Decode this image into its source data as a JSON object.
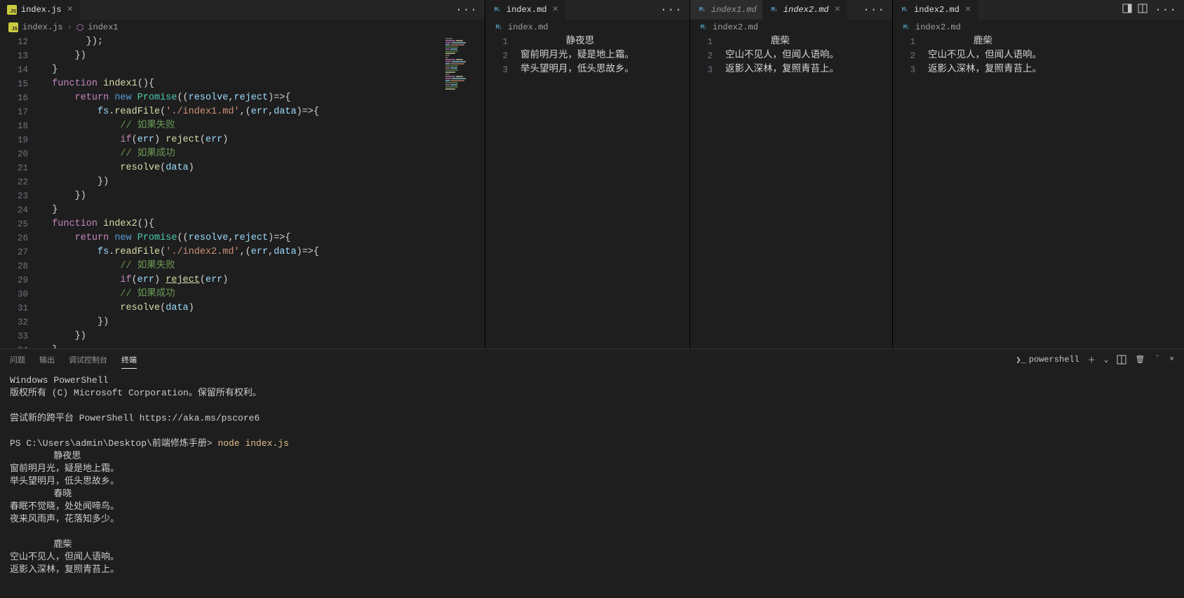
{
  "panes": [
    {
      "tabs": [
        {
          "label": "index.js",
          "icon": "js",
          "active": true,
          "italic": false,
          "closeable": true
        }
      ],
      "actions_dots": "···",
      "breadcrumb": [
        {
          "icon": "js",
          "label": "index.js"
        },
        {
          "icon": "sym",
          "label": "index1"
        }
      ],
      "line_start": 12,
      "code": [
        [
          [
            "punc",
            "        });"
          ]
        ],
        [
          [
            "punc",
            "      })"
          ]
        ],
        [
          [
            "punc",
            "  }"
          ]
        ],
        [
          [
            "kw",
            "  function "
          ],
          [
            "fn",
            "index1"
          ],
          [
            "punc",
            "(){"
          ]
        ],
        [
          [
            "kw",
            "      return "
          ],
          [
            "op",
            "new "
          ],
          [
            "cls",
            "Promise"
          ],
          [
            "punc",
            "(("
          ],
          [
            "var",
            "resolve"
          ],
          [
            "punc",
            ","
          ],
          [
            "var",
            "reject"
          ],
          [
            "punc",
            ")=>{"
          ]
        ],
        [
          [
            "var",
            "          fs"
          ],
          [
            "punc",
            "."
          ],
          [
            "fn",
            "readFile"
          ],
          [
            "punc",
            "("
          ],
          [
            "str",
            "'./index1.md'"
          ],
          [
            "punc",
            ",("
          ],
          [
            "var",
            "err"
          ],
          [
            "punc",
            ","
          ],
          [
            "var",
            "data"
          ],
          [
            "punc",
            ")=>{"
          ]
        ],
        [
          [
            "com",
            "              // 如果失败"
          ]
        ],
        [
          [
            "kw",
            "              if"
          ],
          [
            "punc",
            "("
          ],
          [
            "var",
            "err"
          ],
          [
            "punc",
            ") "
          ],
          [
            "fn",
            "reject"
          ],
          [
            "punc",
            "("
          ],
          [
            "var",
            "err"
          ],
          [
            "punc",
            ")"
          ]
        ],
        [
          [
            "com",
            "              // 如果成功"
          ]
        ],
        [
          [
            "fn",
            "              resolve"
          ],
          [
            "punc",
            "("
          ],
          [
            "var",
            "data"
          ],
          [
            "punc",
            ")"
          ]
        ],
        [
          [
            "punc",
            "          })"
          ]
        ],
        [
          [
            "punc",
            "      })"
          ]
        ],
        [
          [
            "punc",
            "  }"
          ]
        ],
        [
          [
            "kw",
            "  function "
          ],
          [
            "fn",
            "index2"
          ],
          [
            "punc",
            "(){"
          ]
        ],
        [
          [
            "kw",
            "      return "
          ],
          [
            "op",
            "new "
          ],
          [
            "cls",
            "Promise"
          ],
          [
            "punc",
            "(("
          ],
          [
            "var",
            "resolve"
          ],
          [
            "punc",
            ","
          ],
          [
            "var",
            "reject"
          ],
          [
            "punc",
            ")=>{"
          ]
        ],
        [
          [
            "var",
            "          fs"
          ],
          [
            "punc",
            "."
          ],
          [
            "fn",
            "readFile"
          ],
          [
            "punc",
            "("
          ],
          [
            "str",
            "'./index2.md'"
          ],
          [
            "punc",
            ",("
          ],
          [
            "var",
            "err"
          ],
          [
            "punc",
            ","
          ],
          [
            "var",
            "data"
          ],
          [
            "punc",
            ")=>{"
          ]
        ],
        [
          [
            "com",
            "              // 如果失败"
          ]
        ],
        [
          [
            "kw",
            "              if"
          ],
          [
            "punc",
            "("
          ],
          [
            "var",
            "err"
          ],
          [
            "punc",
            ") "
          ],
          [
            "fn under",
            "reject"
          ],
          [
            "punc",
            "("
          ],
          [
            "var",
            "err"
          ],
          [
            "punc",
            ")"
          ]
        ],
        [
          [
            "com",
            "              // 如果成功"
          ]
        ],
        [
          [
            "fn",
            "              resolve"
          ],
          [
            "punc",
            "("
          ],
          [
            "var",
            "data"
          ],
          [
            "punc",
            ")"
          ]
        ],
        [
          [
            "punc",
            "          })"
          ]
        ],
        [
          [
            "punc",
            "      })"
          ]
        ],
        [
          [
            "punc",
            "  }"
          ]
        ]
      ]
    },
    {
      "tabs": [
        {
          "label": "index.md",
          "icon": "md",
          "active": true,
          "italic": false,
          "closeable": true
        }
      ],
      "actions_dots": "···",
      "breadcrumb": [
        {
          "icon": "md",
          "label": "index.md"
        }
      ],
      "line_start": 1,
      "lines": [
        "        静夜思",
        "窗前明月光，疑是地上霜。",
        "举头望明月，低头思故乡。"
      ]
    },
    {
      "tabs": [
        {
          "label": "index1.md",
          "icon": "md",
          "active": false,
          "italic": true,
          "closeable": false
        },
        {
          "label": "index2.md",
          "icon": "md",
          "active": true,
          "italic": true,
          "closeable": true
        }
      ],
      "actions_dots": "···",
      "breadcrumb": [
        {
          "icon": "md",
          "label": "index2.md"
        }
      ],
      "line_start": 1,
      "lines": [
        "        鹿柴",
        "空山不见人，但闻人语响。",
        "返影入深林，复照青苔上。"
      ]
    },
    {
      "tabs": [
        {
          "label": "index2.md",
          "icon": "md",
          "active": true,
          "italic": false,
          "closeable": true
        }
      ],
      "layout_icons": true,
      "actions_dots": "···",
      "breadcrumb": [
        {
          "icon": "md",
          "label": "index2.md"
        }
      ],
      "line_start": 1,
      "lines": [
        "        鹿柴",
        "空山不见人，但闻人语响。",
        "返影入深林，复照青苔上。"
      ]
    }
  ],
  "panel": {
    "tabs": [
      {
        "label": "问题",
        "active": false
      },
      {
        "label": "输出",
        "active": false
      },
      {
        "label": "调试控制台",
        "active": false
      },
      {
        "label": "终端",
        "active": true
      }
    ],
    "terminal_picker": "powershell",
    "terminal_output": [
      {
        "type": "text",
        "text": "Windows PowerShell"
      },
      {
        "type": "text",
        "text": "版权所有 (C) Microsoft Corporation。保留所有权利。"
      },
      {
        "type": "blank"
      },
      {
        "type": "text",
        "text": "尝试新的跨平台 PowerShell https://aka.ms/pscore6"
      },
      {
        "type": "blank"
      },
      {
        "type": "prompt",
        "prompt": "PS C:\\Users\\admin\\Desktop\\前端修炼手册> ",
        "cmd": "node index.js"
      },
      {
        "type": "text",
        "text": "        静夜思"
      },
      {
        "type": "text",
        "text": "窗前明月光，疑是地上霜。"
      },
      {
        "type": "text",
        "text": "举头望明月，低头思故乡。"
      },
      {
        "type": "text",
        "text": "        春晓"
      },
      {
        "type": "text",
        "text": "春眠不觉晓，处处闻啼鸟。"
      },
      {
        "type": "text",
        "text": "夜来风雨声，花落知多少。"
      },
      {
        "type": "blank"
      },
      {
        "type": "text",
        "text": "        鹿柴"
      },
      {
        "type": "text",
        "text": "空山不见人，但闻人语响。"
      },
      {
        "type": "text",
        "text": "返影入深林，复照青苔上。"
      }
    ]
  }
}
